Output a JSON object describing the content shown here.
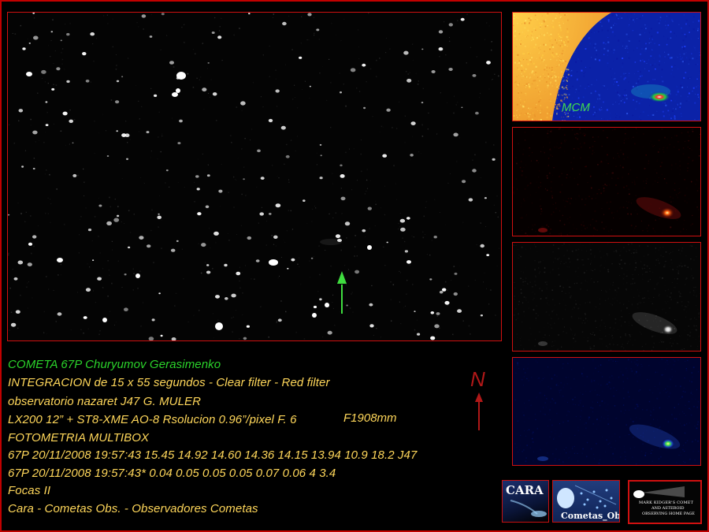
{
  "caption": {
    "line1": "COMETA  67P Churyumov Gerasimenko",
    "line2": "INTEGRACION de 15 x 55 segundos - Clear filter - Red filter",
    "line3": "observatorio nazaret J47  G. MULER",
    "line4": "LX200 12” +  ST8-XME AO-8  Rsolucion 0.96”/pixel   F. 6",
    "line4_extra": "F1908mm",
    "line5": "FOTOMETRIA MULTIBOX",
    "line6": "67P 20/11/2008 19:57:43 15.45 14.92 14.60 14.36 14.15 13.94 10.9 18.2 J47",
    "line7": "67P 20/11/2008 19:57:43* 0.04 0.05 0.05 0.05 0.07 0.06 4 3.4",
    "line8": "Focas II",
    "line9": "Cara - Cometas Obs. - Observadores Cometas"
  },
  "thumb1_label": "MCM",
  "north_label": "N",
  "logos": {
    "cara": "CARA",
    "cometas_obs": "Cometas_Obs",
    "kidger_line1": "MARK KIDGER'S COMET",
    "kidger_line2": "AND ASTEROID",
    "kidger_line3": "OBSERVING HOME PAGE"
  },
  "colors": {
    "frame": "#c00000",
    "caption_green": "#2bd42b",
    "caption_yellow": "#ffd75a",
    "north": "#b01818",
    "pointer_arrow": "#3fdc3f"
  }
}
